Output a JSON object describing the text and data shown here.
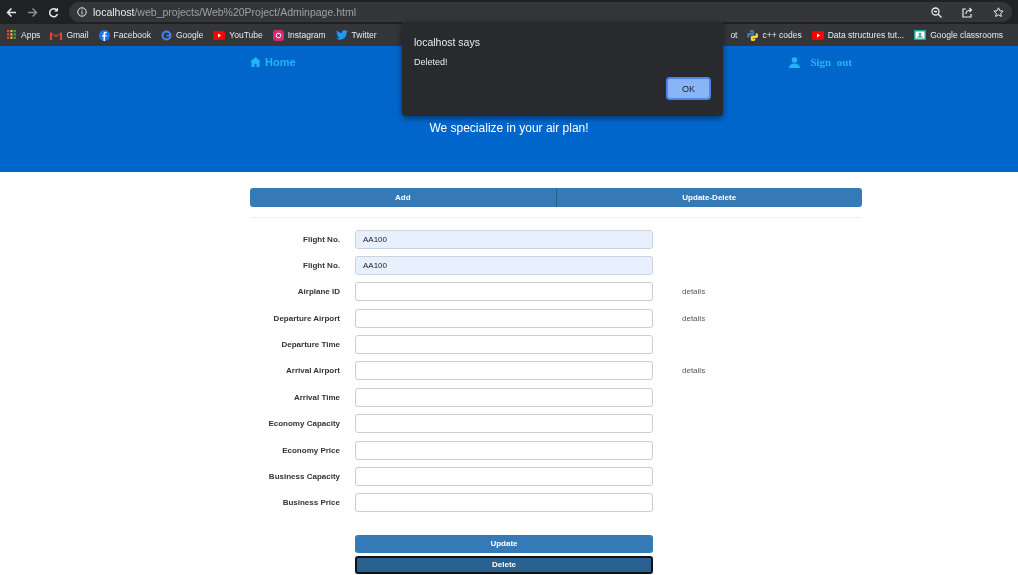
{
  "browser": {
    "url_host": "localhost",
    "url_path": "/web_projects/Web%20Project/Adminpage.html",
    "bookmarks": [
      {
        "label": "Apps",
        "kind": "apps"
      },
      {
        "label": "Gmail",
        "kind": "gmail"
      },
      {
        "label": "Facebook",
        "kind": "facebook"
      },
      {
        "label": "Google",
        "kind": "google"
      },
      {
        "label": "YouTube",
        "kind": "youtube"
      },
      {
        "label": "Instagram",
        "kind": "instagram"
      },
      {
        "label": "Twitter",
        "kind": "twitter"
      },
      {
        "label": "ot",
        "kind": "plain"
      },
      {
        "label": "c++ codes",
        "kind": "python"
      },
      {
        "label": "Data structures tut...",
        "kind": "youtube"
      },
      {
        "label": "Google classrooms",
        "kind": "classroom"
      }
    ]
  },
  "header": {
    "home": "Home",
    "sign_out": "Sign  out",
    "tagline": "We specialize in your air plan!"
  },
  "tabs": [
    {
      "label": "Add",
      "selected": false
    },
    {
      "label": "Update-Delete",
      "selected": false
    }
  ],
  "fields": [
    {
      "label": "Flight No.",
      "value": "AA100",
      "autofilled": true
    },
    {
      "label": "Flight No.",
      "value": "AA100",
      "autofilled": true
    },
    {
      "label": "Airplane ID",
      "link": "details",
      "autofilled": false
    },
    {
      "label": "Departure Airport",
      "link": "details",
      "autofilled": false
    },
    {
      "label": "Departure Time",
      "autofilled": false
    },
    {
      "label": "Arrival Airport",
      "link": "details",
      "autofilled": false
    },
    {
      "label": "Arrival Time",
      "autofilled": false
    },
    {
      "label": "Economy Capacity",
      "autofilled": false
    },
    {
      "label": "Economy Price",
      "autofilled": false
    },
    {
      "label": "Business Capacity",
      "autofilled": false
    },
    {
      "label": "Business Price",
      "autofilled": false
    }
  ],
  "buttons": [
    {
      "label": "Update",
      "focused": false
    },
    {
      "label": "Delete",
      "focused": true
    }
  ],
  "dialog": {
    "title": "localhost says",
    "message": "Deleted!",
    "button": "OK"
  }
}
